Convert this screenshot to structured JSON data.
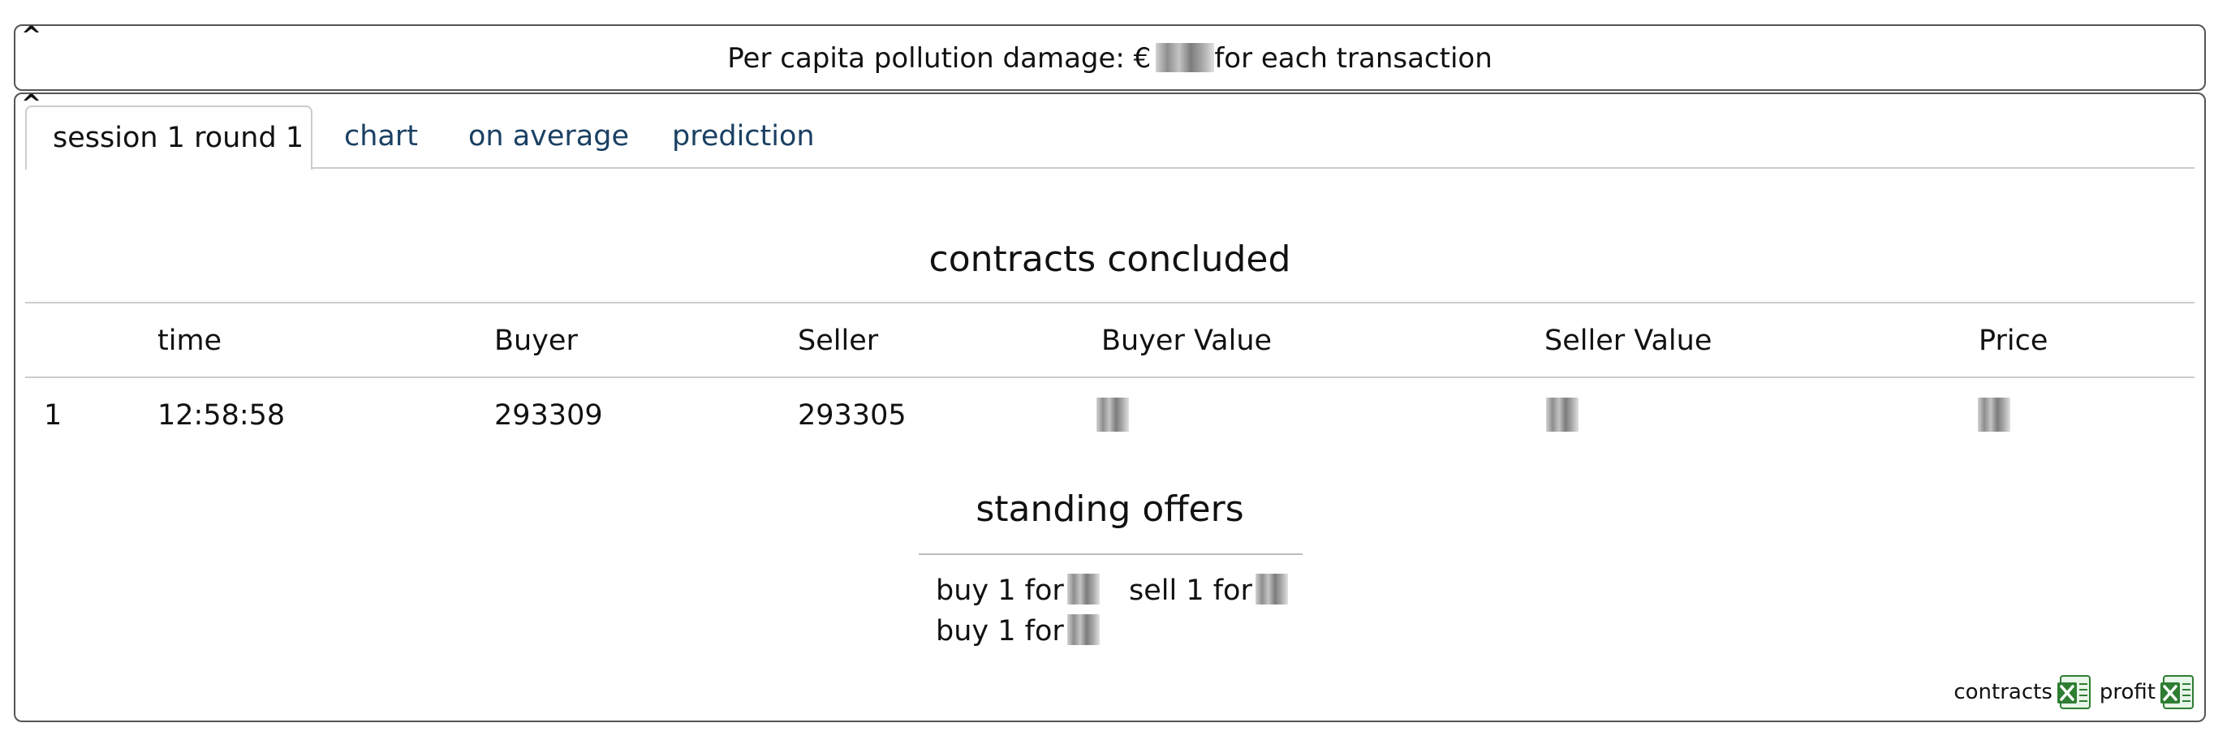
{
  "top_panel": {
    "caret": "^",
    "pollution_label": "Per capita pollution damage: €",
    "pollution_suffix": "for each transaction"
  },
  "main_panel": {
    "caret": "^",
    "tabs": [
      {
        "label": "session 1 round 1",
        "active": true
      },
      {
        "label": "chart",
        "active": false
      },
      {
        "label": "on average",
        "active": false
      },
      {
        "label": "prediction",
        "active": false
      }
    ],
    "contracts": {
      "title": "contracts concluded",
      "columns": [
        "",
        "time",
        "Buyer",
        "Seller",
        "Buyer Value",
        "Seller Value",
        "Price"
      ],
      "rows": [
        {
          "index": "1",
          "time": "12:58:58",
          "buyer": "293309",
          "seller": "293305"
        }
      ]
    },
    "standing_offers": {
      "title": "standing offers",
      "offers": [
        {
          "label": "buy 1 for"
        },
        {
          "label": "sell 1 for"
        },
        {
          "label": "buy 1 for"
        }
      ]
    },
    "downloads": {
      "contracts_label": "contracts",
      "profit_label": "profit",
      "icon": "excel-file-icon"
    }
  },
  "colors": {
    "tab_link": "#1b4063",
    "border": "#555555",
    "excel_green": "#2e7d32"
  }
}
